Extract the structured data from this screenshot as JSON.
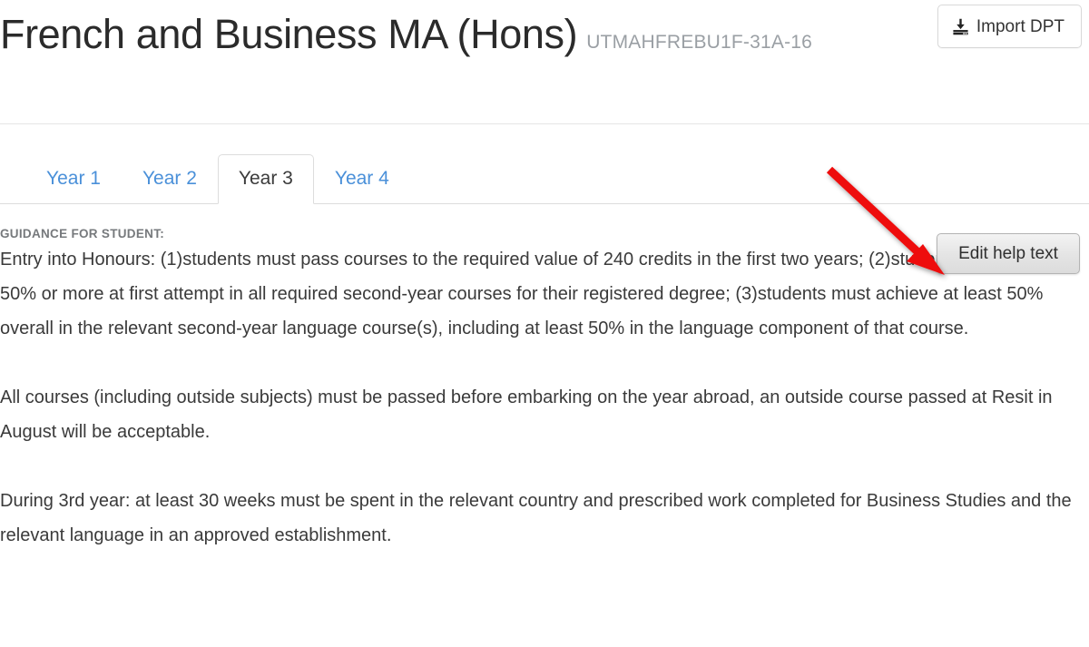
{
  "header": {
    "title": "French and Business MA (Hons)",
    "code": "UTMAHFREBU1F-31A-16",
    "import_button": {
      "label": "Import DPT",
      "icon": "download-icon"
    }
  },
  "tabs": [
    {
      "label": "Year 1",
      "active": false
    },
    {
      "label": "Year 2",
      "active": false
    },
    {
      "label": "Year 3",
      "active": true
    },
    {
      "label": "Year 4",
      "active": false
    }
  ],
  "content": {
    "guidance_label": "GUIDANCE FOR STUDENT:",
    "edit_button_label": "Edit help text",
    "paragraphs": [
      "Entry into Honours: (1)students must pass courses to the required value of 240 credits in the first two years; (2)students must achieve 50% or more at first attempt in all required second-year courses for their registered degree; (3)students must achieve at least 50% overall in the relevant second-year language course(s), including at least 50% in the language component of that course.",
      "All courses (including outside subjects) must be passed before embarking on the year abroad, an outside course passed at Resit in August will be acceptable.",
      "During 3rd year: at least 30 weeks must be spent in the relevant country and prescribed work completed for Business Studies and the relevant language in an approved establishment."
    ]
  },
  "annotation": {
    "arrow_color": "#ee1111",
    "arrow_points_to": "Edit help text"
  },
  "colors": {
    "link_blue": "#4a90d9",
    "body_text": "#3a3a3a",
    "muted_gray": "#9a9fa4",
    "border": "#dddddd"
  }
}
